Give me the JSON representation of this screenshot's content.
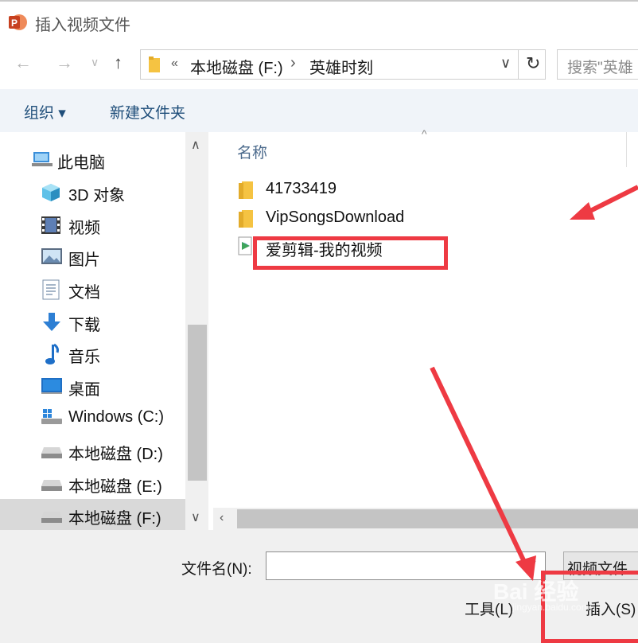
{
  "window": {
    "title": "插入视频文件"
  },
  "address_bar": {
    "overflow_chevron": "«",
    "crumbs": [
      "本地磁盘 (F:)",
      "英雄时刻"
    ],
    "separator": "›"
  },
  "search": {
    "placeholder": "搜索\"英雄"
  },
  "toolbar": {
    "organize": "组织 ▾",
    "new_folder": "新建文件夹"
  },
  "nav": {
    "items": [
      {
        "label": "此电脑",
        "icon": "pc-icon"
      },
      {
        "label": "3D 对象",
        "icon": "3d-objects-icon"
      },
      {
        "label": "视频",
        "icon": "videos-icon"
      },
      {
        "label": "图片",
        "icon": "pictures-icon"
      },
      {
        "label": "文档",
        "icon": "documents-icon"
      },
      {
        "label": "下载",
        "icon": "download-icon"
      },
      {
        "label": "音乐",
        "icon": "music-icon"
      },
      {
        "label": "桌面",
        "icon": "desktop-icon"
      },
      {
        "label": "Windows (C:)",
        "icon": "windows-drive-icon"
      },
      {
        "label": "本地磁盘 (D:)",
        "icon": "drive-icon"
      },
      {
        "label": "本地磁盘 (E:)",
        "icon": "drive-icon"
      },
      {
        "label": "本地磁盘 (F:)",
        "icon": "drive-icon"
      }
    ],
    "selected": "本地磁盘 (F:)"
  },
  "file_list": {
    "column_header": "名称",
    "items": [
      {
        "name": "41733419",
        "type": "folder"
      },
      {
        "name": "VipSongsDownload",
        "type": "folder"
      },
      {
        "name": "爱剪辑-我的视频",
        "type": "video"
      }
    ]
  },
  "bottom": {
    "filename_label": "文件名(N):",
    "filename_value": "",
    "filetype": "视频文件",
    "tools": "工具(L)",
    "insert": "插入(S)"
  },
  "watermark": {
    "text": "Bai 经验",
    "sub": "jingyan.baidu.com"
  },
  "colors": {
    "annotation_red": "#ee3a43",
    "toolbar_bg": "#f0f4f9",
    "folder_yellow": "#f5c342"
  }
}
